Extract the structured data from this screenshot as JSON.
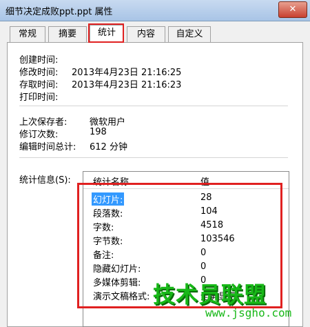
{
  "window": {
    "title": "细节决定成败ppt.ppt 属性",
    "close_label": "✕"
  },
  "tabs": [
    {
      "label": "常规"
    },
    {
      "label": "摘要"
    },
    {
      "label": "统计"
    },
    {
      "label": "内容"
    },
    {
      "label": "自定义"
    }
  ],
  "dates": {
    "created_label": "创建时间:",
    "modified_label": "修改时间:",
    "modified_value": "2013年4月23日 21:16:25",
    "accessed_label": "存取时间:",
    "accessed_value": "2013年4月23日 21:16:23",
    "printed_label": "打印时间:"
  },
  "info": {
    "last_saved_label": "上次保存者:",
    "last_saved_value": "微软用户",
    "revision_label": "修订次数:",
    "revision_value": "198",
    "edit_time_label": "编辑时间总计:",
    "edit_time_value": "612 分钟"
  },
  "stats": {
    "label": "统计信息(S):",
    "header_name": "统计名称",
    "header_value": "值",
    "rows": [
      {
        "name": "幻灯片:",
        "value": "28"
      },
      {
        "name": "段落数:",
        "value": "104"
      },
      {
        "name": "字数:",
        "value": "4518"
      },
      {
        "name": "字节数:",
        "value": "103546"
      },
      {
        "name": "备注:",
        "value": "0"
      },
      {
        "name": "隐藏幻灯片:",
        "value": "0"
      },
      {
        "name": "多媒体剪辑:",
        "value": "0"
      },
      {
        "name": "演示文稿格式:",
        "value": "全屏显示"
      }
    ]
  },
  "watermark": {
    "text": "技术员联盟",
    "url": "www.jsgho.com"
  },
  "colors": {
    "highlight": "#e02020",
    "selection": "#3399ff",
    "watermark": "#18b818"
  }
}
